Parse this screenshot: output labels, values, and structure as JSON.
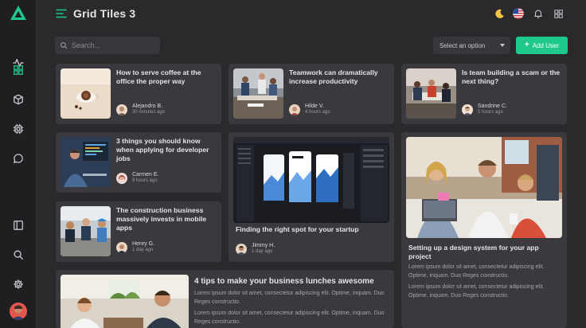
{
  "app": {
    "title": "Grid Tiles 3"
  },
  "sidebar": {
    "logo": "triangle-logo",
    "items": [
      {
        "name": "activity",
        "icon": "activity-icon"
      },
      {
        "name": "grid",
        "icon": "grid-icon",
        "active": true
      },
      {
        "name": "box",
        "icon": "cube-icon"
      },
      {
        "name": "chip",
        "icon": "cpu-icon"
      },
      {
        "name": "chat",
        "icon": "chat-icon"
      }
    ],
    "bottom_items": [
      {
        "name": "panel",
        "icon": "sidebar-panel-icon"
      },
      {
        "name": "search",
        "icon": "search-icon"
      },
      {
        "name": "settings",
        "icon": "gear-icon"
      }
    ]
  },
  "toolbar": {
    "search_placeholder": "Search...",
    "select_value": "Select an option",
    "add_user_label": "Add User"
  },
  "colors": {
    "accent": "#1fc98c",
    "card": "#3a3a3e",
    "background": "#2a2a2d"
  },
  "cards": [
    {
      "title": "How to serve coffee at the office the proper way",
      "author": "Alejandro B.",
      "time": "30 minutes ago"
    },
    {
      "title": "Teamwork can dramatically increase productivity",
      "author": "Hilde V.",
      "time": "4 hours ago"
    },
    {
      "title": "Is team building a scam or the next thing?",
      "author": "Sandrine C.",
      "time": "5 hours ago"
    },
    {
      "title": "3 things you should know when applying for developer jobs",
      "author": "Carmen E.",
      "time": "8 hours ago"
    },
    {
      "title": "The construction business massively invests in mobile apps",
      "author": "Henry G.",
      "time": "1 day ago"
    },
    {
      "title": "Finding the right spot for your startup",
      "author": "Jimmy H.",
      "time": "1 day ago"
    },
    {
      "title": "Setting up a design system for your app project",
      "para1": "Lorem ipsum dolor sit amet, consectetur adipiscing elit. Optime, inquam. Duo Reges constructio.",
      "para2": "Lorem ipsum dolor sit amet, consectetur adipiscing elit. Optime, inquam. Duo Reges constructio."
    },
    {
      "title": "4 tips to make your business lunches awesome",
      "para1": "Lorem ipsum dolor sit amet, consectetur adipiscing elit. Optime, inquam. Duo Reges constructio.",
      "para2": "Lorem ipsum dolor sit amet, consectetur adipiscing elit. Optime, inquam. Duo Reges constructio."
    }
  ]
}
